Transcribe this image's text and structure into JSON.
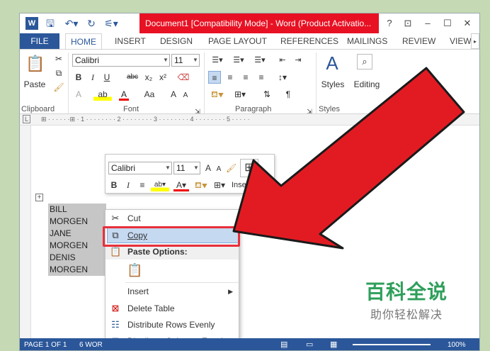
{
  "title_bar": {
    "app_icon": "W",
    "window_title": "Document1 [Compatibility Mode] - Word (Product Activatio...",
    "help": "?",
    "ribbon_display": "⊡",
    "minimize": "–",
    "maximize": "☐",
    "close": "✕"
  },
  "ribbon_tabs": {
    "file": "FILE",
    "tabs": [
      "HOME",
      "INSERT",
      "DESIGN",
      "PAGE LAYOUT",
      "REFERENCES",
      "MAILINGS",
      "REVIEW",
      "VIEW"
    ]
  },
  "ribbon": {
    "clipboard": {
      "paste_label": "Paste",
      "group_label": "Clipboard"
    },
    "font": {
      "font_name": "Calibri",
      "font_size": "11",
      "group_label": "Font",
      "bold": "B",
      "italic": "I",
      "underline": "U",
      "strike": "abc",
      "sub": "x₂",
      "sup": "x²",
      "grow": "A",
      "shrink": "A",
      "case": "Aa"
    },
    "paragraph": {
      "group_label": "Paragraph"
    },
    "styles": {
      "label": "Styles",
      "group_label": "Styles"
    },
    "editing": {
      "label": "Editing"
    }
  },
  "mini_toolbar": {
    "font_name": "Calibri",
    "font_size": "11",
    "bold": "B",
    "italic": "I",
    "insert_label": "Insert"
  },
  "table_cells": [
    "BILL",
    "MORGEN",
    "JANE",
    "MORGEN",
    "DENIS",
    "MORGEN"
  ],
  "context_menu": {
    "cut": "Cut",
    "copy": "Copy",
    "paste_options": "Paste Options:",
    "insert": "Insert",
    "delete_table": "Delete Table",
    "distribute_rows": "Distribute Rows Evenly",
    "distribute_columns": "Distribute Columns Evenly"
  },
  "status_bar": {
    "page": "PAGE 1 OF 1",
    "words": "6 WOR",
    "zoom": "100%"
  },
  "watermark": {
    "title": "百科全说",
    "subtitle": "助你轻松解决"
  },
  "colors": {
    "accent": "#2b579a",
    "title_highlight": "#e81123",
    "arrow": "#e21b23",
    "watermark_green": "#2f9f5b"
  }
}
